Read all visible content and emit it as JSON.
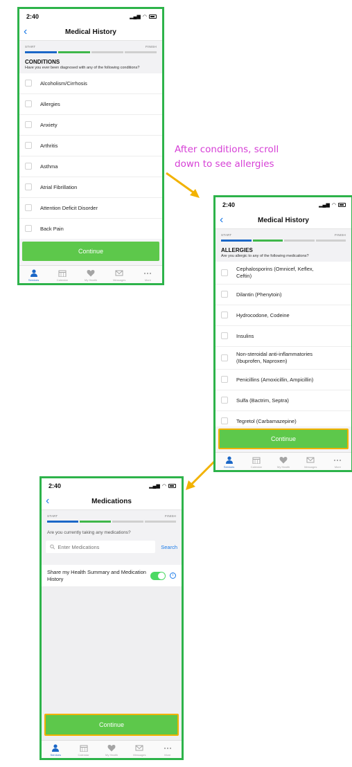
{
  "annotation": {
    "line1": "After conditions, scroll",
    "line2": "down to see allergies"
  },
  "status": {
    "time": "2:40"
  },
  "tabs": [
    {
      "label": "Services",
      "icon": "person-icon"
    },
    {
      "label": "Calendar",
      "icon": "calendar-icon"
    },
    {
      "label": "My Health",
      "icon": "heart-icon"
    },
    {
      "label": "Messages",
      "icon": "envelope-icon"
    },
    {
      "label": "More",
      "icon": "more-icon"
    }
  ],
  "screens": {
    "conditions": {
      "title": "Medical History",
      "progress": {
        "start": "START",
        "finish": "FINISH",
        "step": 2,
        "total": 4
      },
      "section_title": "CONDITIONS",
      "section_sub": "Have you ever been diagnosed with any of the following conditions?",
      "items": [
        "Alcoholism/Cirrhosis",
        "Allergies",
        "Anxiety",
        "Arthritis",
        "Asthma",
        "Atrial Fibrillation",
        "Attention Deficit Disorder",
        "Back Pain"
      ],
      "continue": "Continue"
    },
    "allergies": {
      "title": "Medical History",
      "progress": {
        "start": "START",
        "finish": "FINISH",
        "step": 2,
        "total": 4
      },
      "section_title": "ALLERGIES",
      "section_sub": "Are you allergic to any of the following medications?",
      "items": [
        "Cephalosporins (Omnicef, Keflex, Ceftin)",
        "Dilantin (Phenytoin)",
        "Hydrocodone, Codeine",
        "Insulins",
        "Non-steroidal anti-inflammatories (Ibuprofen, Naproxen)",
        "Penicillins (Amoxicillin, Ampicillin)",
        "Sulfa (Bactrim, Septra)",
        "Tegretol (Carbamazepine)"
      ],
      "continue": "Continue"
    },
    "medications": {
      "title": "Medications",
      "progress": {
        "start": "START",
        "finish": "FINISH",
        "step": 2,
        "total": 4
      },
      "question": "Are you currently taking any medications?",
      "search_placeholder": "Enter Medications",
      "search_label": "Search",
      "share_label": "Share my Health Summary and Medication History",
      "share_enabled": true,
      "info_glyph": "i",
      "continue": "Continue"
    }
  },
  "colors": {
    "frame": "#2db34a",
    "highlight": "#f2b200",
    "cta": "#5dc84b",
    "link": "#1a7ae8",
    "annotation": "#d63fd6",
    "progress_done": "#1b67c7",
    "progress_current": "#3fb74a"
  }
}
